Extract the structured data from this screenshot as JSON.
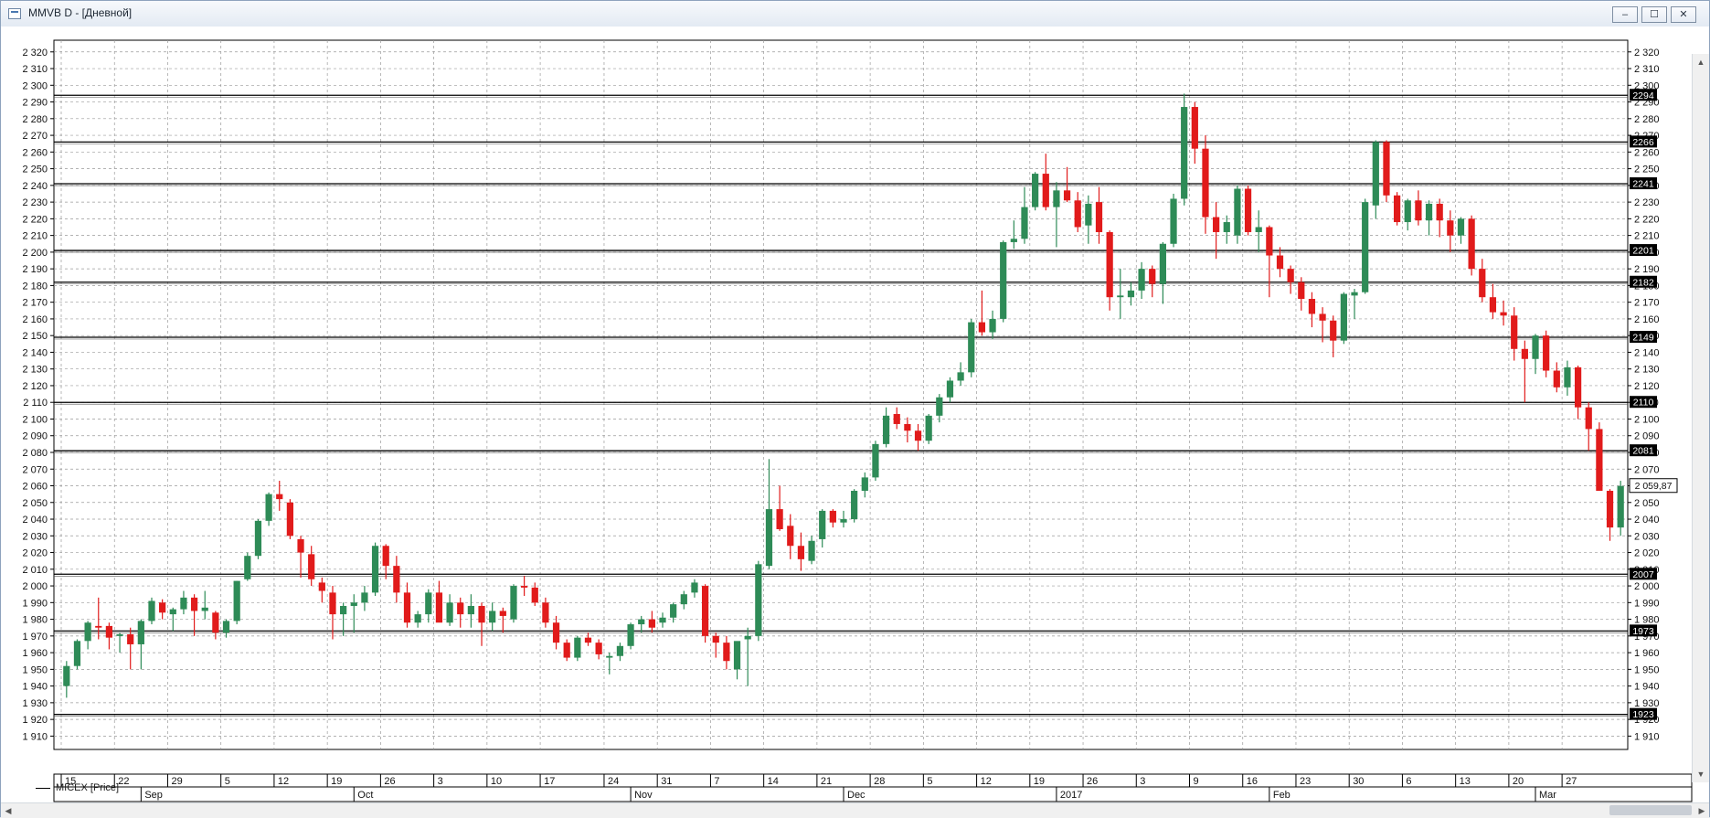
{
  "window": {
    "title": "MMVB D - [Дневной]",
    "minimize_icon": "minimize-icon",
    "maximize_icon": "maximize-icon",
    "close_icon": "close-icon"
  },
  "colors": {
    "up": "#2e8b57",
    "down": "#e11b1b",
    "grid": "#9a9a9a",
    "axis": "#000000",
    "level": "#000000",
    "label_bg": "#000000",
    "label_fg": "#ffffff",
    "bg": "#ffffff"
  },
  "legend": {
    "label": "MICEX [Price]"
  },
  "chart_data": {
    "type": "candlestick",
    "title": "MMVB D - [Дневной]",
    "series_name": "MICEX [Price]",
    "ylim": [
      1902,
      2327
    ],
    "y_ticks": [
      "2 320",
      "2 310",
      "2 300",
      "2 290",
      "2 280",
      "2 270",
      "2 260",
      "2 250",
      "2 240",
      "2 230",
      "2 220",
      "2 210",
      "2 200",
      "2 190",
      "2 180",
      "2 170",
      "2 160",
      "2 150",
      "2 140",
      "2 130",
      "2 120",
      "2 110",
      "2 100",
      "2 090",
      "2 080",
      "2 070",
      "2 060",
      "2 050",
      "2 040",
      "2 030",
      "2 020",
      "2 010",
      "2 000",
      "1 990",
      "1 980",
      "1 970",
      "1 960",
      "1 950",
      "1 940",
      "1 930",
      "1 920",
      "1 910"
    ],
    "y_ticks_right": [
      "2 320",
      "2 310",
      "2 300",
      "2 290",
      "2 280",
      "2 270",
      "2 260",
      "2 250",
      "2 240",
      "2 230",
      "2 220",
      "2 210",
      "2 200",
      "2 190",
      "2 180",
      "2 170",
      "2 160",
      "2 150",
      "2 140",
      "2 130",
      "2 120",
      "2 110",
      "2 100",
      "2 090",
      "2 080",
      "2 070",
      "2 060",
      "2 050",
      "2 040",
      "2 030",
      "2 020",
      "2 010",
      "2 000",
      "1 990",
      "1 980",
      "1 970",
      "1 960",
      "1 950",
      "1 940",
      "1 930",
      "1 920",
      "1 910"
    ],
    "levels": [
      {
        "value": 2294,
        "label": "2294"
      },
      {
        "value": 2266,
        "label": "2266"
      },
      {
        "value": 2241,
        "label": "2241"
      },
      {
        "value": 2201,
        "label": "2201"
      },
      {
        "value": 2182,
        "label": "2182"
      },
      {
        "value": 2149,
        "label": "2149"
      },
      {
        "value": 2110,
        "label": "2110"
      },
      {
        "value": 2081,
        "label": "2081"
      },
      {
        "value": 2007,
        "label": "2007"
      },
      {
        "value": 1973,
        "label": "1973"
      },
      {
        "value": 1923,
        "label": "1923"
      }
    ],
    "last_price": {
      "value": 2059.87,
      "label": "2 059,87"
    },
    "x_day_labels": [
      "15",
      "22",
      "29",
      "5",
      "12",
      "19",
      "26",
      "3",
      "10",
      "17",
      "24",
      "31",
      "7",
      "14",
      "21",
      "28",
      "5",
      "12",
      "19",
      "26",
      "3",
      "9",
      "16",
      "23",
      "30",
      "6",
      "13",
      "20",
      "27"
    ],
    "x_month_labels": [
      {
        "label": "Sep",
        "after_day": 2
      },
      {
        "label": "Oct",
        "after_day": 6
      },
      {
        "label": "Nov",
        "after_day": 11
      },
      {
        "label": "Dec",
        "after_day": 15
      },
      {
        "label": "2017",
        "after_day": 19
      },
      {
        "label": "Feb",
        "after_day": 23
      },
      {
        "label": "Mar",
        "after_day": 28
      }
    ],
    "candles": [
      {
        "o": 1940,
        "h": 1955,
        "l": 1933,
        "c": 1952
      },
      {
        "o": 1952,
        "h": 1968,
        "l": 1950,
        "c": 1967
      },
      {
        "o": 1967,
        "h": 1979,
        "l": 1962,
        "c": 1978
      },
      {
        "o": 1976,
        "h": 1993,
        "l": 1968,
        "c": 1975
      },
      {
        "o": 1976,
        "h": 1978,
        "l": 1962,
        "c": 1969
      },
      {
        "o": 1970,
        "h": 1972,
        "l": 1960,
        "c": 1971
      },
      {
        "o": 1971,
        "h": 1975,
        "l": 1950,
        "c": 1965
      },
      {
        "o": 1965,
        "h": 1980,
        "l": 1950,
        "c": 1979
      },
      {
        "o": 1979,
        "h": 1993,
        "l": 1977,
        "c": 1991
      },
      {
        "o": 1990,
        "h": 1992,
        "l": 1980,
        "c": 1984
      },
      {
        "o": 1983,
        "h": 1987,
        "l": 1973,
        "c": 1986
      },
      {
        "o": 1986,
        "h": 1997,
        "l": 1983,
        "c": 1993
      },
      {
        "o": 1993,
        "h": 1995,
        "l": 1970,
        "c": 1985
      },
      {
        "o": 1985,
        "h": 1997,
        "l": 1980,
        "c": 1987
      },
      {
        "o": 1984,
        "h": 1985,
        "l": 1968,
        "c": 1972
      },
      {
        "o": 1972,
        "h": 1980,
        "l": 1969,
        "c": 1979
      },
      {
        "o": 1979,
        "h": 2003,
        "l": 1977,
        "c": 2003
      },
      {
        "o": 2004,
        "h": 2020,
        "l": 2003,
        "c": 2018
      },
      {
        "o": 2018,
        "h": 2040,
        "l": 2016,
        "c": 2039
      },
      {
        "o": 2039,
        "h": 2056,
        "l": 2036,
        "c": 2055
      },
      {
        "o": 2055,
        "h": 2063,
        "l": 2045,
        "c": 2052
      },
      {
        "o": 2050,
        "h": 2052,
        "l": 2028,
        "c": 2030
      },
      {
        "o": 2028,
        "h": 2030,
        "l": 2005,
        "c": 2020
      },
      {
        "o": 2019,
        "h": 2024,
        "l": 2000,
        "c": 2004
      },
      {
        "o": 2002,
        "h": 2005,
        "l": 1990,
        "c": 1997
      },
      {
        "o": 1996,
        "h": 2000,
        "l": 1968,
        "c": 1983
      },
      {
        "o": 1983,
        "h": 1990,
        "l": 1970,
        "c": 1988
      },
      {
        "o": 1988,
        "h": 1995,
        "l": 1972,
        "c": 1990
      },
      {
        "o": 1990,
        "h": 2000,
        "l": 1985,
        "c": 1996
      },
      {
        "o": 1996,
        "h": 2026,
        "l": 1994,
        "c": 2024
      },
      {
        "o": 2024,
        "h": 2025,
        "l": 2004,
        "c": 2012
      },
      {
        "o": 2012,
        "h": 2018,
        "l": 1990,
        "c": 1996
      },
      {
        "o": 1996,
        "h": 2002,
        "l": 1975,
        "c": 1978
      },
      {
        "o": 1978,
        "h": 1985,
        "l": 1975,
        "c": 1983
      },
      {
        "o": 1983,
        "h": 1998,
        "l": 1978,
        "c": 1996
      },
      {
        "o": 1996,
        "h": 2003,
        "l": 1987,
        "c": 1978
      },
      {
        "o": 1978,
        "h": 1995,
        "l": 1976,
        "c": 1990
      },
      {
        "o": 1990,
        "h": 1993,
        "l": 1975,
        "c": 1983
      },
      {
        "o": 1983,
        "h": 1995,
        "l": 1975,
        "c": 1988
      },
      {
        "o": 1988,
        "h": 1990,
        "l": 1964,
        "c": 1978
      },
      {
        "o": 1978,
        "h": 1990,
        "l": 1973,
        "c": 1985
      },
      {
        "o": 1985,
        "h": 1987,
        "l": 1972,
        "c": 1982
      },
      {
        "o": 1980,
        "h": 2001,
        "l": 1978,
        "c": 2000
      },
      {
        "o": 2000,
        "h": 2006,
        "l": 1994,
        "c": 1999
      },
      {
        "o": 1999,
        "h": 2002,
        "l": 1988,
        "c": 1990
      },
      {
        "o": 1990,
        "h": 1993,
        "l": 1975,
        "c": 1978
      },
      {
        "o": 1978,
        "h": 1982,
        "l": 1962,
        "c": 1966
      },
      {
        "o": 1966,
        "h": 1968,
        "l": 1955,
        "c": 1957
      },
      {
        "o": 1957,
        "h": 1970,
        "l": 1955,
        "c": 1969
      },
      {
        "o": 1969,
        "h": 1972,
        "l": 1964,
        "c": 1966
      },
      {
        "o": 1966,
        "h": 1968,
        "l": 1956,
        "c": 1959
      },
      {
        "o": 1957,
        "h": 1960,
        "l": 1947,
        "c": 1958
      },
      {
        "o": 1958,
        "h": 1966,
        "l": 1955,
        "c": 1964
      },
      {
        "o": 1964,
        "h": 1978,
        "l": 1962,
        "c": 1977
      },
      {
        "o": 1977,
        "h": 1982,
        "l": 1972,
        "c": 1980
      },
      {
        "o": 1980,
        "h": 1985,
        "l": 1972,
        "c": 1975
      },
      {
        "o": 1978,
        "h": 1984,
        "l": 1975,
        "c": 1981
      },
      {
        "o": 1981,
        "h": 1990,
        "l": 1978,
        "c": 1989
      },
      {
        "o": 1989,
        "h": 1997,
        "l": 1986,
        "c": 1995
      },
      {
        "o": 1996,
        "h": 2004,
        "l": 1993,
        "c": 2002
      },
      {
        "o": 2000,
        "h": 2001,
        "l": 1966,
        "c": 1970
      },
      {
        "o": 1970,
        "h": 1972,
        "l": 1957,
        "c": 1966
      },
      {
        "o": 1966,
        "h": 1970,
        "l": 1950,
        "c": 1955
      },
      {
        "o": 1950,
        "h": 1960,
        "l": 1944,
        "c": 1967
      },
      {
        "o": 1968,
        "h": 1975,
        "l": 1940,
        "c": 1970
      },
      {
        "o": 1970,
        "h": 2015,
        "l": 1967,
        "c": 2013
      },
      {
        "o": 2012,
        "h": 2076,
        "l": 2010,
        "c": 2046
      },
      {
        "o": 2046,
        "h": 2060,
        "l": 2033,
        "c": 2034
      },
      {
        "o": 2036,
        "h": 2043,
        "l": 2016,
        "c": 2024
      },
      {
        "o": 2024,
        "h": 2032,
        "l": 2009,
        "c": 2016
      },
      {
        "o": 2015,
        "h": 2030,
        "l": 2013,
        "c": 2027
      },
      {
        "o": 2028,
        "h": 2046,
        "l": 2023,
        "c": 2045
      },
      {
        "o": 2045,
        "h": 2046,
        "l": 2035,
        "c": 2038
      },
      {
        "o": 2038,
        "h": 2045,
        "l": 2035,
        "c": 2040
      },
      {
        "o": 2040,
        "h": 2058,
        "l": 2038,
        "c": 2057
      },
      {
        "o": 2057,
        "h": 2068,
        "l": 2053,
        "c": 2065
      },
      {
        "o": 2065,
        "h": 2087,
        "l": 2063,
        "c": 2085
      },
      {
        "o": 2085,
        "h": 2107,
        "l": 2083,
        "c": 2102
      },
      {
        "o": 2103,
        "h": 2107,
        "l": 2094,
        "c": 2097
      },
      {
        "o": 2097,
        "h": 2101,
        "l": 2086,
        "c": 2093
      },
      {
        "o": 2093,
        "h": 2097,
        "l": 2081,
        "c": 2087
      },
      {
        "o": 2087,
        "h": 2103,
        "l": 2085,
        "c": 2102
      },
      {
        "o": 2102,
        "h": 2115,
        "l": 2098,
        "c": 2113
      },
      {
        "o": 2113,
        "h": 2125,
        "l": 2110,
        "c": 2123
      },
      {
        "o": 2123,
        "h": 2134,
        "l": 2120,
        "c": 2128
      },
      {
        "o": 2128,
        "h": 2160,
        "l": 2125,
        "c": 2158
      },
      {
        "o": 2158,
        "h": 2177,
        "l": 2150,
        "c": 2152
      },
      {
        "o": 2152,
        "h": 2165,
        "l": 2148,
        "c": 2160
      },
      {
        "o": 2160,
        "h": 2207,
        "l": 2158,
        "c": 2206
      },
      {
        "o": 2206,
        "h": 2219,
        "l": 2202,
        "c": 2208
      },
      {
        "o": 2208,
        "h": 2239,
        "l": 2205,
        "c": 2227
      },
      {
        "o": 2227,
        "h": 2248,
        "l": 2225,
        "c": 2247
      },
      {
        "o": 2247,
        "h": 2259,
        "l": 2225,
        "c": 2227
      },
      {
        "o": 2227,
        "h": 2242,
        "l": 2203,
        "c": 2237
      },
      {
        "o": 2237,
        "h": 2251,
        "l": 2230,
        "c": 2231
      },
      {
        "o": 2231,
        "h": 2236,
        "l": 2212,
        "c": 2215
      },
      {
        "o": 2216,
        "h": 2234,
        "l": 2205,
        "c": 2229
      },
      {
        "o": 2230,
        "h": 2239,
        "l": 2205,
        "c": 2212
      },
      {
        "o": 2212,
        "h": 2213,
        "l": 2165,
        "c": 2173
      },
      {
        "o": 2173,
        "h": 2190,
        "l": 2160,
        "c": 2174
      },
      {
        "o": 2173,
        "h": 2182,
        "l": 2168,
        "c": 2177
      },
      {
        "o": 2177,
        "h": 2194,
        "l": 2172,
        "c": 2190
      },
      {
        "o": 2190,
        "h": 2192,
        "l": 2173,
        "c": 2181
      },
      {
        "o": 2181,
        "h": 2206,
        "l": 2169,
        "c": 2205
      },
      {
        "o": 2205,
        "h": 2235,
        "l": 2203,
        "c": 2232
      },
      {
        "o": 2232,
        "h": 2295,
        "l": 2228,
        "c": 2287
      },
      {
        "o": 2287,
        "h": 2290,
        "l": 2253,
        "c": 2262
      },
      {
        "o": 2262,
        "h": 2270,
        "l": 2211,
        "c": 2221
      },
      {
        "o": 2221,
        "h": 2230,
        "l": 2196,
        "c": 2212
      },
      {
        "o": 2212,
        "h": 2222,
        "l": 2205,
        "c": 2218
      },
      {
        "o": 2210,
        "h": 2240,
        "l": 2205,
        "c": 2238
      },
      {
        "o": 2238,
        "h": 2240,
        "l": 2210,
        "c": 2212
      },
      {
        "o": 2212,
        "h": 2225,
        "l": 2200,
        "c": 2215
      },
      {
        "o": 2215,
        "h": 2216,
        "l": 2173,
        "c": 2198
      },
      {
        "o": 2198,
        "h": 2203,
        "l": 2185,
        "c": 2190
      },
      {
        "o": 2190,
        "h": 2192,
        "l": 2175,
        "c": 2182
      },
      {
        "o": 2182,
        "h": 2185,
        "l": 2165,
        "c": 2172
      },
      {
        "o": 2172,
        "h": 2176,
        "l": 2155,
        "c": 2163
      },
      {
        "o": 2163,
        "h": 2167,
        "l": 2146,
        "c": 2159
      },
      {
        "o": 2159,
        "h": 2162,
        "l": 2137,
        "c": 2147
      },
      {
        "o": 2147,
        "h": 2176,
        "l": 2145,
        "c": 2175
      },
      {
        "o": 2174,
        "h": 2178,
        "l": 2160,
        "c": 2176
      },
      {
        "o": 2176,
        "h": 2232,
        "l": 2175,
        "c": 2230
      },
      {
        "o": 2228,
        "h": 2267,
        "l": 2220,
        "c": 2266
      },
      {
        "o": 2266,
        "h": 2267,
        "l": 2230,
        "c": 2234
      },
      {
        "o": 2234,
        "h": 2236,
        "l": 2216,
        "c": 2218
      },
      {
        "o": 2218,
        "h": 2232,
        "l": 2213,
        "c": 2231
      },
      {
        "o": 2231,
        "h": 2237,
        "l": 2216,
        "c": 2219
      },
      {
        "o": 2219,
        "h": 2231,
        "l": 2210,
        "c": 2229
      },
      {
        "o": 2229,
        "h": 2232,
        "l": 2209,
        "c": 2219
      },
      {
        "o": 2219,
        "h": 2225,
        "l": 2200,
        "c": 2210
      },
      {
        "o": 2210,
        "h": 2221,
        "l": 2205,
        "c": 2220
      },
      {
        "o": 2220,
        "h": 2222,
        "l": 2186,
        "c": 2190
      },
      {
        "o": 2190,
        "h": 2196,
        "l": 2170,
        "c": 2173
      },
      {
        "o": 2173,
        "h": 2181,
        "l": 2160,
        "c": 2164
      },
      {
        "o": 2164,
        "h": 2171,
        "l": 2156,
        "c": 2162
      },
      {
        "o": 2162,
        "h": 2167,
        "l": 2135,
        "c": 2142
      },
      {
        "o": 2142,
        "h": 2147,
        "l": 2110,
        "c": 2136
      },
      {
        "o": 2136,
        "h": 2151,
        "l": 2127,
        "c": 2150
      },
      {
        "o": 2150,
        "h": 2153,
        "l": 2125,
        "c": 2129
      },
      {
        "o": 2129,
        "h": 2134,
        "l": 2116,
        "c": 2119
      },
      {
        "o": 2119,
        "h": 2135,
        "l": 2114,
        "c": 2131
      },
      {
        "o": 2131,
        "h": 2132,
        "l": 2100,
        "c": 2107
      },
      {
        "o": 2107,
        "h": 2110,
        "l": 2081,
        "c": 2094
      },
      {
        "o": 2094,
        "h": 2098,
        "l": 2057,
        "c": 2057
      },
      {
        "o": 2057,
        "h": 2058,
        "l": 2027,
        "c": 2035
      },
      {
        "o": 2035,
        "h": 2063,
        "l": 2030,
        "c": 2059.87
      }
    ]
  }
}
